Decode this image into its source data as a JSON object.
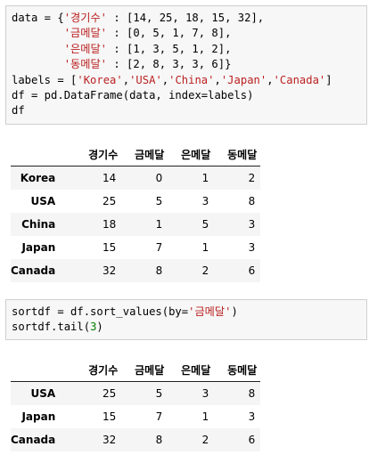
{
  "cell1": {
    "line1_prefix": "data = {",
    "key1": "'경기수'",
    "vals1": " : [14, 25, 18, 15, 32],",
    "key2": "'금메달'",
    "vals2": " : [0, 5, 1, 7, 8],",
    "key3": "'은메달'",
    "vals3": " : [1, 3, 5, 1, 2],",
    "key4": "'동메달'",
    "vals4": " : [2, 8, 3, 3, 6]}",
    "labels_prefix": "labels = [",
    "label_strs": [
      "'Korea'",
      "'USA'",
      "'China'",
      "'Japan'",
      "'Canada'"
    ],
    "labels_suffix": "]",
    "line6": "df = pd.DataFrame(data, index=labels)",
    "line7": "df"
  },
  "table1": {
    "columns": [
      "경기수",
      "금메달",
      "은메달",
      "동메달"
    ],
    "rows": [
      {
        "index": "Korea",
        "values": [
          "14",
          "0",
          "1",
          "2"
        ]
      },
      {
        "index": "USA",
        "values": [
          "25",
          "5",
          "3",
          "8"
        ]
      },
      {
        "index": "China",
        "values": [
          "18",
          "1",
          "5",
          "3"
        ]
      },
      {
        "index": "Japan",
        "values": [
          "15",
          "7",
          "1",
          "3"
        ]
      },
      {
        "index": "Canada",
        "values": [
          "32",
          "8",
          "2",
          "6"
        ]
      }
    ]
  },
  "cell2": {
    "line1_prefix": "sortdf = df.sort_values(by=",
    "line1_str": "'금메달'",
    "line1_suffix": ")",
    "line2_prefix": "sortdf.tail(",
    "line2_num": "3",
    "line2_suffix": ")"
  },
  "table2": {
    "columns": [
      "경기수",
      "금메달",
      "은메달",
      "동메달"
    ],
    "rows": [
      {
        "index": "USA",
        "values": [
          "25",
          "5",
          "3",
          "8"
        ]
      },
      {
        "index": "Japan",
        "values": [
          "15",
          "7",
          "1",
          "3"
        ]
      },
      {
        "index": "Canada",
        "values": [
          "32",
          "8",
          "2",
          "6"
        ]
      }
    ]
  }
}
